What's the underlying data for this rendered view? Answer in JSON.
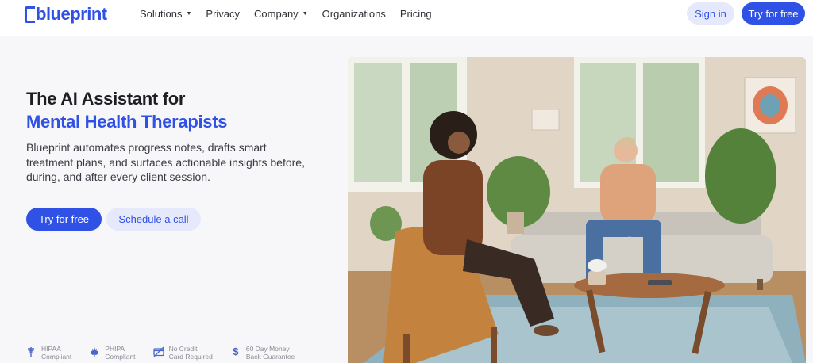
{
  "brand": {
    "name": "blueprint"
  },
  "nav": {
    "items": [
      {
        "label": "Solutions",
        "dropdown": true
      },
      {
        "label": "Privacy",
        "dropdown": false
      },
      {
        "label": "Company",
        "dropdown": true
      },
      {
        "label": "Organizations",
        "dropdown": false
      },
      {
        "label": "Pricing",
        "dropdown": false
      }
    ],
    "signin_label": "Sign in",
    "try_label": "Try for free"
  },
  "hero": {
    "title_line1": "The AI Assistant for",
    "title_line2": "Mental Health Therapists",
    "description": "Blueprint automates progress notes, drafts smart treatment plans, and surfaces actionable insights before, during, and after every client session.",
    "primary_cta": "Try for free",
    "secondary_cta": "Schedule a call"
  },
  "badges": [
    {
      "icon": "caduceus-icon",
      "line1": "HIPAA",
      "line2": "Compliant"
    },
    {
      "icon": "maple-leaf-icon",
      "line1": "PHIPA",
      "line2": "Compliant"
    },
    {
      "icon": "no-card-icon",
      "line1": "No Credit",
      "line2": "Card Required"
    },
    {
      "icon": "dollar-icon",
      "line1": "60 Day Money",
      "line2": "Back Guarantee"
    }
  ],
  "colors": {
    "accent": "#2f51e6",
    "accent_light": "#e6e9fb",
    "text": "#1d1d22"
  }
}
